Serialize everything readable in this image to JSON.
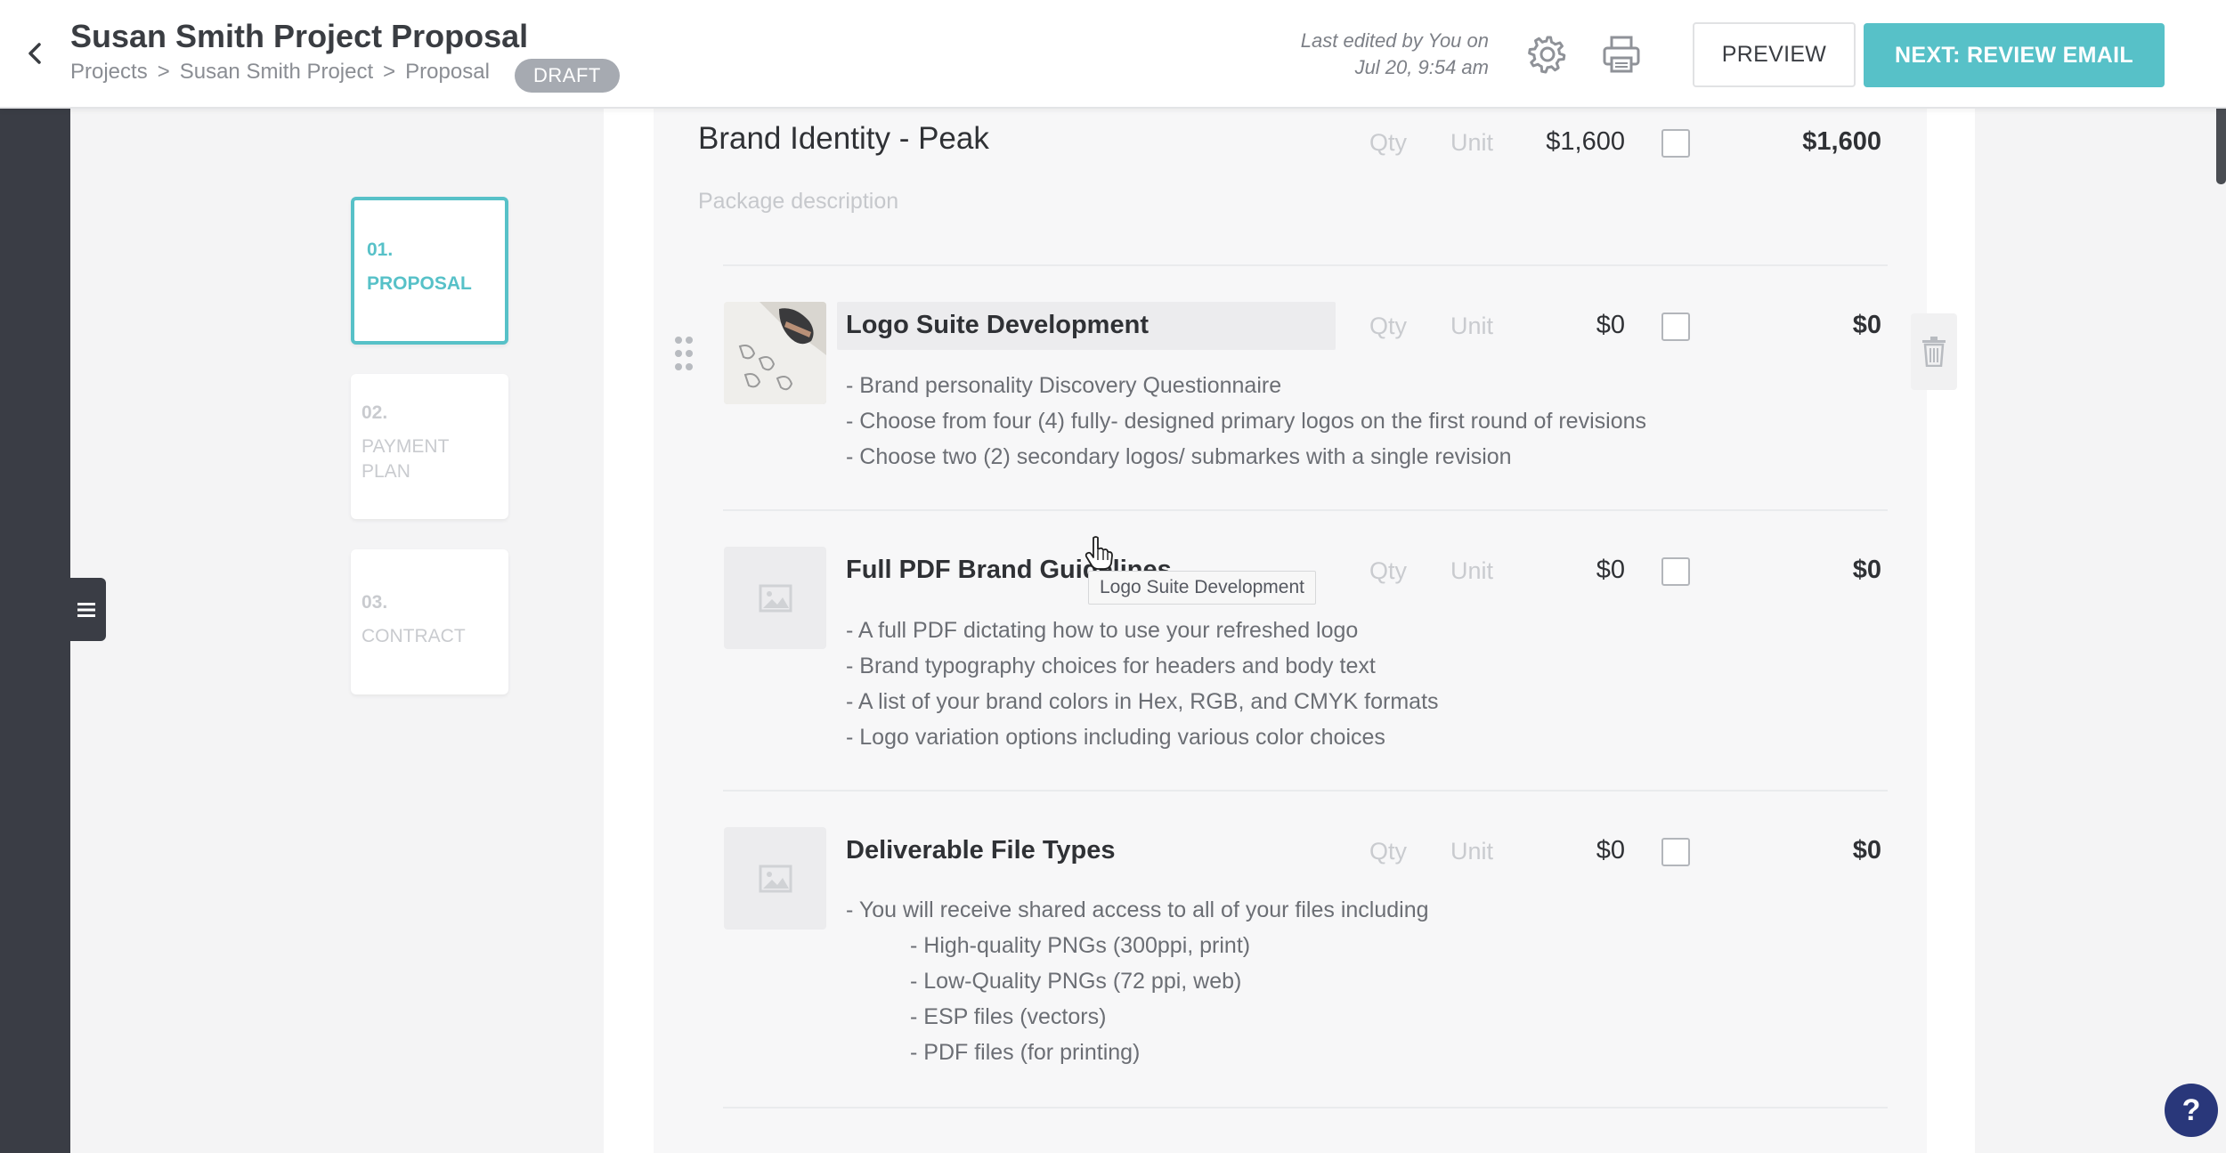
{
  "header": {
    "title": "Susan Smith Project Proposal",
    "breadcrumb": [
      "Projects",
      "Susan Smith Project",
      "Proposal"
    ],
    "breadcrumb_sep": ">",
    "status_badge": "DRAFT",
    "last_edited_line1": "Last edited by You on",
    "last_edited_line2": "Jul 20, 9:54 am",
    "preview_label": "PREVIEW",
    "next_label": "NEXT: REVIEW EMAIL",
    "icons": [
      "back-chevron-icon",
      "gear-icon",
      "print-icon"
    ]
  },
  "steps": [
    {
      "num": "01.",
      "label": "PROPOSAL",
      "active": true
    },
    {
      "num": "02.",
      "label": "PAYMENT PLAN",
      "active": false
    },
    {
      "num": "03.",
      "label": "CONTRACT",
      "active": false
    }
  ],
  "package": {
    "title": "Brand Identity - Peak",
    "description_placeholder": "Package description",
    "qty_placeholder": "Qty",
    "unit_placeholder": "Unit",
    "rate": "$1,600",
    "total": "$1,600"
  },
  "items": [
    {
      "title": "Logo Suite Development",
      "qty_placeholder": "Qty",
      "unit_placeholder": "Unit",
      "rate": "$0",
      "total": "$0",
      "thumbnail": "photo",
      "lines": [
        "- Brand personality Discovery Questionnaire",
        "- Choose from four (4) fully- designed primary logos on the first round of revisions",
        "- Choose two (2) secondary logos/ submarkes with a single revision"
      ]
    },
    {
      "title": "Full PDF Brand Guidelines",
      "qty_placeholder": "Qty",
      "unit_placeholder": "Unit",
      "rate": "$0",
      "total": "$0",
      "thumbnail": "placeholder",
      "lines": [
        "- A full PDF dictating how to use your refreshed logo",
        "- Brand typography choices for headers and body text",
        "- A list of your brand colors in Hex, RGB, and CMYK formats",
        "- Logo variation options including various color choices"
      ]
    },
    {
      "title": "Deliverable File Types",
      "qty_placeholder": "Qty",
      "unit_placeholder": "Unit",
      "rate": "$0",
      "total": "$0",
      "thumbnail": "placeholder",
      "lines": [
        "- You will receive shared access to all of your files including",
        "- High-quality PNGs (300ppi, print)",
        "- Low-Quality PNGs (72 ppi, web)",
        "- ESP files (vectors)",
        "- PDF files (for printing)"
      ]
    }
  ],
  "tooltip": "Logo Suite Development",
  "help_label": "?",
  "colors": {
    "accent": "#57c1c8",
    "rail": "#3a3d45",
    "badge": "#a6aab1",
    "help": "#29377a"
  }
}
